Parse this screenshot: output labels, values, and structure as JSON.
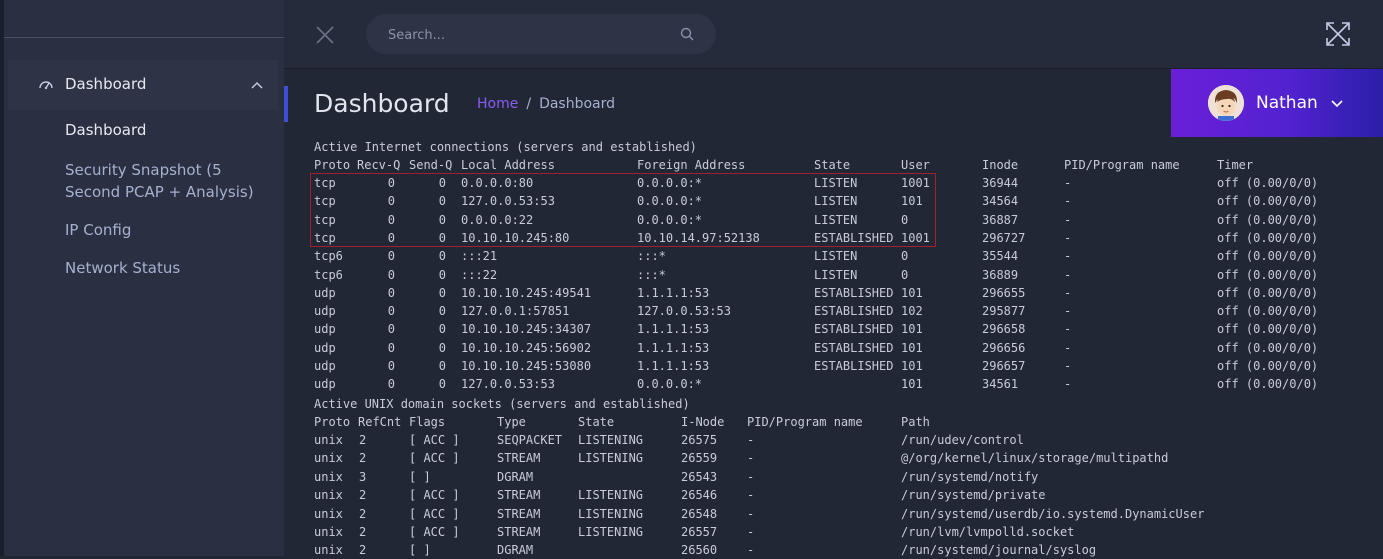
{
  "sidebar": {
    "parent": {
      "label": "Dashboard",
      "icon": "dashboard-icon"
    },
    "items": [
      {
        "label": "Dashboard"
      },
      {
        "label": "Security Snapshot (5",
        "label2": "Second PCAP + Analysis)"
      },
      {
        "label": "IP Config"
      },
      {
        "label": "Network Status"
      }
    ]
  },
  "topbar": {
    "search_placeholder": "Search..."
  },
  "header": {
    "title": "Dashboard",
    "breadcrumb_home": "Home",
    "breadcrumb_sep": "/",
    "breadcrumb_current": "Dashboard"
  },
  "user": {
    "name": "Nathan"
  },
  "netstat": {
    "inet_title": "Active Internet connections (servers and established)",
    "inet_headers": [
      "Proto",
      "Recv-Q",
      "Send-Q",
      "Local Address",
      "Foreign Address",
      "State",
      "User",
      "Inode",
      "PID/Program name",
      "Timer"
    ],
    "inet_rows": [
      [
        "tcp",
        "0",
        "0",
        "0.0.0.0:80",
        "0.0.0.0:*",
        "LISTEN",
        "1001",
        "36944",
        "-",
        "off (0.00/0/0)"
      ],
      [
        "tcp",
        "0",
        "0",
        "127.0.0.53:53",
        "0.0.0.0:*",
        "LISTEN",
        "101",
        "34564",
        "-",
        "off (0.00/0/0)"
      ],
      [
        "tcp",
        "0",
        "0",
        "0.0.0.0:22",
        "0.0.0.0:*",
        "LISTEN",
        "0",
        "36887",
        "-",
        "off (0.00/0/0)"
      ],
      [
        "tcp",
        "0",
        "0",
        "10.10.10.245:80",
        "10.10.14.97:52138",
        "ESTABLISHED",
        "1001",
        "296727",
        "-",
        "off (0.00/0/0)"
      ],
      [
        "tcp6",
        "0",
        "0",
        ":::21",
        ":::*",
        "LISTEN",
        "0",
        "35544",
        "-",
        "off (0.00/0/0)"
      ],
      [
        "tcp6",
        "0",
        "0",
        ":::22",
        ":::*",
        "LISTEN",
        "0",
        "36889",
        "-",
        "off (0.00/0/0)"
      ],
      [
        "udp",
        "0",
        "0",
        "10.10.10.245:49541",
        "1.1.1.1:53",
        "ESTABLISHED",
        "101",
        "296655",
        "-",
        "off (0.00/0/0)"
      ],
      [
        "udp",
        "0",
        "0",
        "127.0.0.1:57851",
        "127.0.0.53:53",
        "ESTABLISHED",
        "102",
        "295877",
        "-",
        "off (0.00/0/0)"
      ],
      [
        "udp",
        "0",
        "0",
        "10.10.10.245:34307",
        "1.1.1.1:53",
        "ESTABLISHED",
        "101",
        "296658",
        "-",
        "off (0.00/0/0)"
      ],
      [
        "udp",
        "0",
        "0",
        "10.10.10.245:56902",
        "1.1.1.1:53",
        "ESTABLISHED",
        "101",
        "296656",
        "-",
        "off (0.00/0/0)"
      ],
      [
        "udp",
        "0",
        "0",
        "10.10.10.245:53080",
        "1.1.1.1:53",
        "ESTABLISHED",
        "101",
        "296657",
        "-",
        "off (0.00/0/0)"
      ],
      [
        "udp",
        "0",
        "0",
        "127.0.0.53:53",
        "0.0.0.0:*",
        "",
        "101",
        "34561",
        "-",
        "off (0.00/0/0)"
      ]
    ],
    "unix_title": "Active UNIX domain sockets (servers and established)",
    "unix_headers": [
      "Proto",
      "RefCnt",
      "Flags",
      "Type",
      "State",
      "I-Node",
      "PID/Program name",
      "Path"
    ],
    "unix_rows": [
      [
        "unix",
        "2",
        "[ ACC ]",
        "SEQPACKET",
        "LISTENING",
        "26575",
        "-",
        "/run/udev/control"
      ],
      [
        "unix",
        "2",
        "[ ACC ]",
        "STREAM",
        "LISTENING",
        "26559",
        "-",
        "@/org/kernel/linux/storage/multipathd"
      ],
      [
        "unix",
        "3",
        "[ ]",
        "DGRAM",
        "",
        "26543",
        "-",
        "/run/systemd/notify"
      ],
      [
        "unix",
        "2",
        "[ ACC ]",
        "STREAM",
        "LISTENING",
        "26546",
        "-",
        "/run/systemd/private"
      ],
      [
        "unix",
        "2",
        "[ ACC ]",
        "STREAM",
        "LISTENING",
        "26548",
        "-",
        "/run/systemd/userdb/io.systemd.DynamicUser"
      ],
      [
        "unix",
        "2",
        "[ ACC ]",
        "STREAM",
        "LISTENING",
        "26557",
        "-",
        "/run/lvm/lvmpolld.socket"
      ],
      [
        "unix",
        "2",
        "[ ]",
        "DGRAM",
        "",
        "26560",
        "-",
        "/run/systemd/journal/syslog"
      ]
    ]
  }
}
